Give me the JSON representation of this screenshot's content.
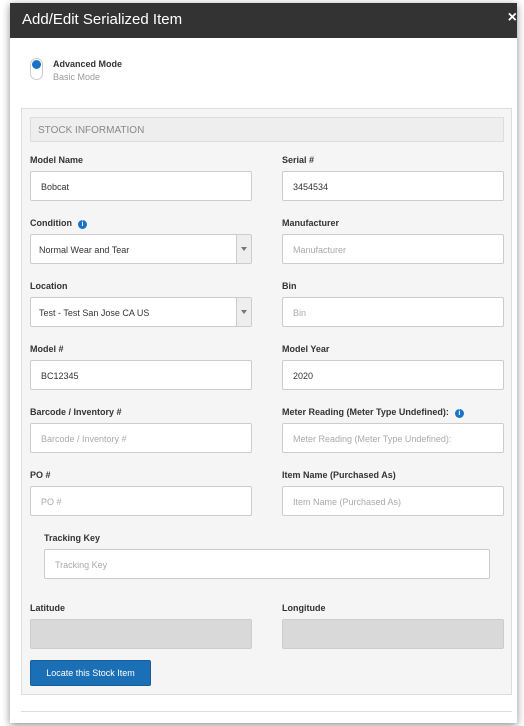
{
  "modal": {
    "title": "Add/Edit Serialized Item",
    "close": "×"
  },
  "mode": {
    "advanced": "Advanced Mode",
    "basic": "Basic Mode",
    "selected": "Advanced Mode"
  },
  "section": {
    "title": "STOCK INFORMATION"
  },
  "fields": {
    "model_name": {
      "label": "Model Name",
      "value": "Bobcat"
    },
    "serial": {
      "label": "Serial #",
      "value": "3454534"
    },
    "condition": {
      "label": "Condition",
      "value": "Normal Wear and Tear"
    },
    "manufacturer": {
      "label": "Manufacturer",
      "placeholder": "Manufacturer"
    },
    "location": {
      "label": "Location",
      "value": "Test - Test San Jose CA US"
    },
    "bin": {
      "label": "Bin",
      "placeholder": "Bin"
    },
    "model_number": {
      "label": "Model #",
      "value": "BC12345"
    },
    "model_year": {
      "label": "Model Year",
      "value": "2020"
    },
    "barcode": {
      "label": "Barcode / Inventory #",
      "placeholder": "Barcode / Inventory #"
    },
    "meter_reading": {
      "label": "Meter Reading (Meter Type Undefined):",
      "placeholder": "Meter Reading (Meter Type Undefined):"
    },
    "po": {
      "label": "PO #",
      "placeholder": "PO #"
    },
    "item_name": {
      "label": "Item Name (Purchased As)",
      "placeholder": "Item Name (Purchased As)"
    },
    "tracking_key": {
      "label": "Tracking Key",
      "placeholder": "Tracking Key"
    },
    "latitude": {
      "label": "Latitude"
    },
    "longitude": {
      "label": "Longitude"
    }
  },
  "buttons": {
    "locate": "Locate this Stock Item"
  },
  "icons": {
    "info": "info-icon",
    "accent": "#1a73c8"
  }
}
